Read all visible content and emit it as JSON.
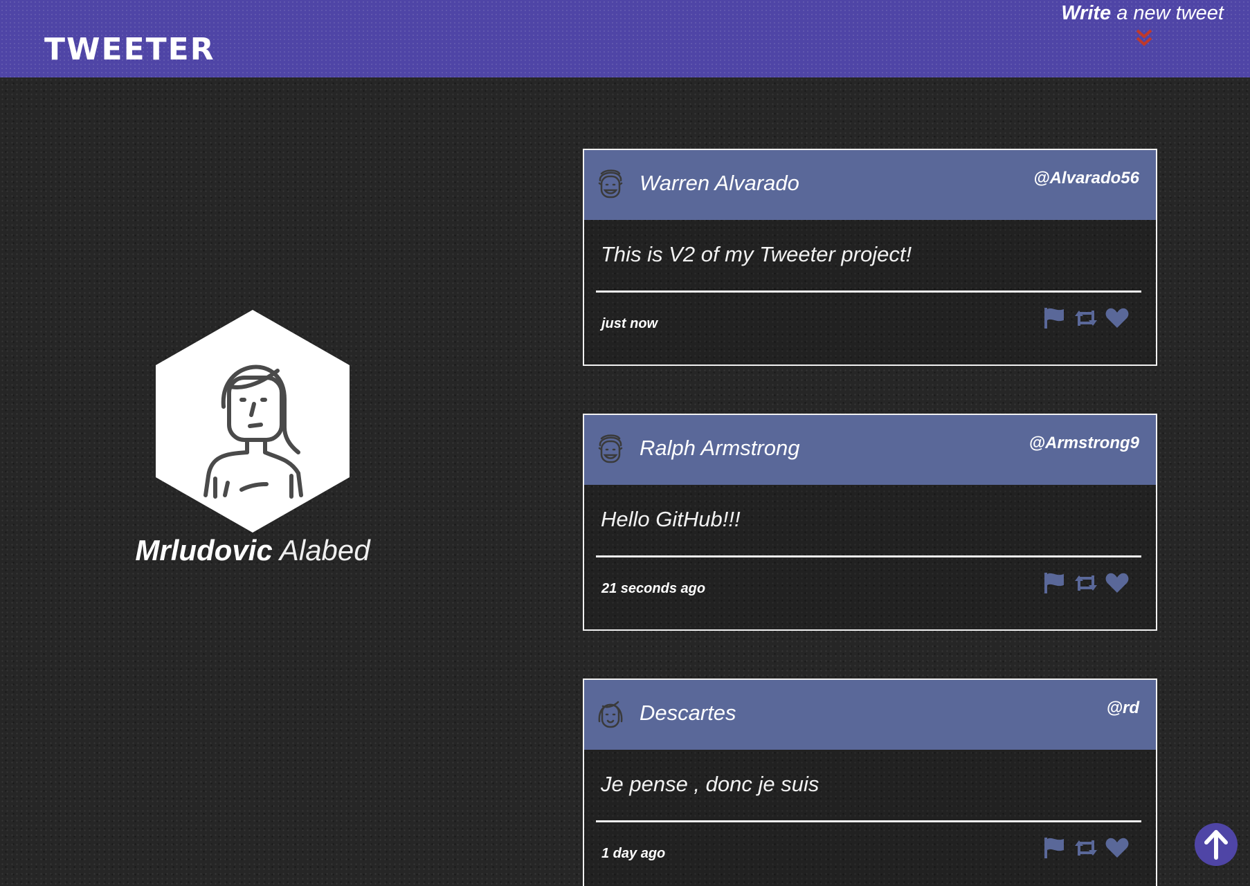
{
  "header": {
    "brand": "TWEETER",
    "compose_strong": "Write",
    "compose_rest": " a new tweet",
    "compose_icon": "double-chevron-down-icon"
  },
  "profile": {
    "first_name": "Mrludovic",
    "last_name": "Alabed",
    "avatar_icon": "woman-avatar-icon"
  },
  "tweets": [
    {
      "name": "Warren Alvarado",
      "handle": "@Alvarado56",
      "text": "This is V2 of my Tweeter project!",
      "time": "just now",
      "avatar_icon": "man-face-icon"
    },
    {
      "name": "Ralph Armstrong",
      "handle": "@Armstrong9",
      "text": "Hello GitHub!!!",
      "time": "21 seconds ago",
      "avatar_icon": "man-face-icon"
    },
    {
      "name": "Descartes",
      "handle": "@rd",
      "text": "Je pense , donc je suis",
      "time": "1 day ago",
      "avatar_icon": "woman-face-icon"
    }
  ],
  "actions": [
    "flag-icon",
    "retweet-icon",
    "heart-icon"
  ],
  "colors": {
    "header_bg": "#4f45a6",
    "tweet_header_bg": "#5a6899",
    "action_icon": "#5a6899",
    "chevron": "#c0392b",
    "page_bg": "#262626"
  },
  "scroll_top_icon": "arrow-up-icon"
}
